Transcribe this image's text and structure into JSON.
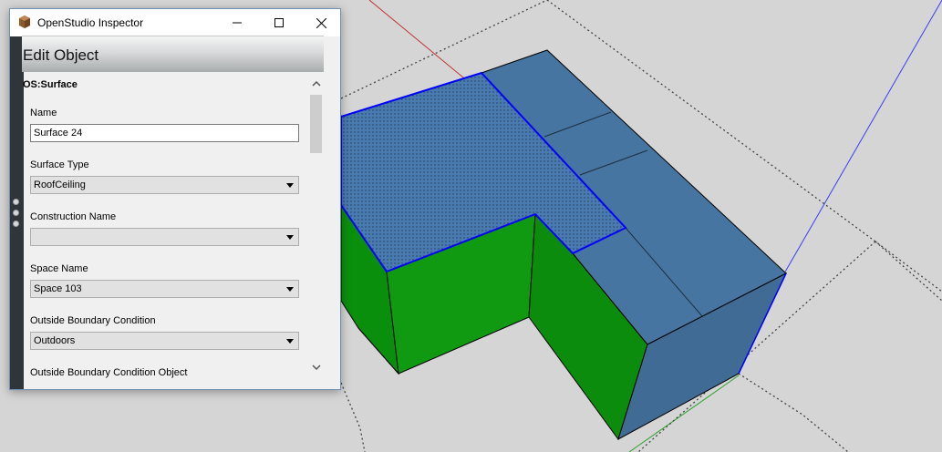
{
  "window": {
    "title": "OpenStudio Inspector"
  },
  "header": {
    "title": "Edit Object"
  },
  "object": {
    "class_name": "OS:Surface",
    "fields": [
      {
        "label": "Name",
        "type": "text",
        "value": "Surface 24"
      },
      {
        "label": "Surface Type",
        "type": "select",
        "value": "RoofCeiling"
      },
      {
        "label": "Construction Name",
        "type": "select",
        "value": ""
      },
      {
        "label": "Space Name",
        "type": "select",
        "value": "Space 103"
      },
      {
        "label": "Outside Boundary Condition",
        "type": "select",
        "value": "Outdoors"
      },
      {
        "label": "Outside Boundary Condition Object",
        "type": "select",
        "value": ""
      }
    ]
  },
  "icons": {
    "app": "openstudio-box-icon",
    "minimize": "minimize-icon",
    "maximize": "maximize-icon",
    "close": "close-icon",
    "dropdown": "chevron-down-icon",
    "scroll_up": "chevron-up-icon",
    "scroll_down": "chevron-down-icon"
  },
  "colors": {
    "roof_blue": "#4575a0",
    "selected_roof": "#3f6fa6",
    "wall_green": "#0d9510",
    "selection_outline": "#0000ff",
    "sidebar_dark": "#2f3538",
    "viewport_background": "#d5d5d5"
  }
}
